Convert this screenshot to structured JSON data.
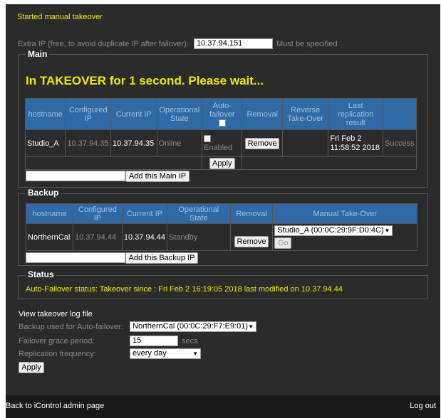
{
  "status_message": "Started manual takeover",
  "extra_ip": {
    "label": "Extra IP (free, to avoid duplicate IP after failover):",
    "value": "10.37.94.151",
    "note": "Must be specified"
  },
  "main": {
    "legend": "Main",
    "banner": "In TAKEOVER for 1 second.  Please wait...",
    "headers": {
      "hostname": "hostname",
      "configured_ip": "Configured IP",
      "current_ip": "Current IP",
      "operational_state": "Operational State",
      "auto_failover": "Auto-failover",
      "removal": "Removal",
      "reverse_takeover": "Reverse Take-Over",
      "last_replication": "Last replication result"
    },
    "row": {
      "hostname": "Studio_A",
      "configured_ip": "10.37.94.35",
      "current_ip": "10.37.94.35",
      "state": "Online",
      "enabled_label": "Enabled",
      "remove_label": "Remove",
      "replication_date": "Fri Feb 2 11:58:52 2018",
      "replication_result": "Success"
    },
    "apply_label": "Apply",
    "add_ip_label": "Add this Main IP",
    "add_ip_value": ""
  },
  "backup": {
    "legend": "Backup",
    "headers": {
      "hostname": "hostname",
      "configured_ip": "Configured IP",
      "current_ip": "Current IP",
      "operational_state": "Operational State",
      "removal": "Removal",
      "manual_takeover": "Manual Take-Over"
    },
    "row": {
      "hostname": "NorthernCal",
      "configured_ip": "10.37.94.44",
      "current_ip": "10.37.94.44",
      "state": "Standby",
      "remove_label": "Remove",
      "takeover_target": "Studio_A (00:0C:29:9F:D0:4C)",
      "go_label": "Go"
    },
    "add_ip_label": "Add this Backup IP",
    "add_ip_value": ""
  },
  "status": {
    "legend": "Status",
    "text": "Auto-Failover status: Takeover since : Fri Feb 2 16:19:05 2018 last modified on 10.37.94.44"
  },
  "settings": {
    "view_log_label": "View takeover log file",
    "backup_label": "Backup used for Auto-failover:",
    "backup_value": "NorthernCal (00:0C:29:F7:E9:01)",
    "grace_label": "Failover grace period:",
    "grace_value": "15",
    "grace_unit": "secs",
    "replication_label": "Replication frequency:",
    "replication_value": "every day",
    "apply_label": "Apply"
  },
  "footer": {
    "back_label": "Back to iControl admin page",
    "logout_label": "Log out"
  },
  "colors": {
    "panel_bg": "#2b2b2b",
    "header_blue": "#2f6aa6",
    "banner_yellow": "#f2e600"
  }
}
